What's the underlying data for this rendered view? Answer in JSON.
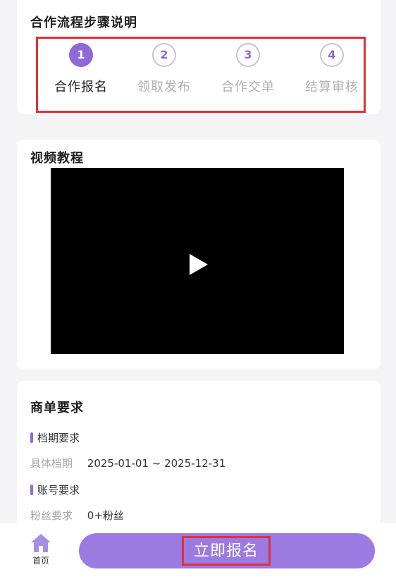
{
  "process": {
    "title": "合作流程步骤说明",
    "steps": [
      {
        "num": "1",
        "label": "合作报名",
        "active": true
      },
      {
        "num": "2",
        "label": "领取发布",
        "active": false
      },
      {
        "num": "3",
        "label": "合作交单",
        "active": false
      },
      {
        "num": "4",
        "label": "结算审核",
        "active": false
      }
    ]
  },
  "video": {
    "title": "视频教程",
    "icon": "play-icon"
  },
  "requirements": {
    "title": "商单要求",
    "schedule": {
      "heading": "档期要求",
      "key": "具体档期",
      "value": "2025-01-01 ~ 2025-12-31"
    },
    "account": {
      "heading": "账号要求",
      "key": "粉丝要求",
      "value": "0+粉丝"
    }
  },
  "bottom_bar": {
    "home_label": "首页",
    "home_icon": "home-icon",
    "signup_label": "立即报名"
  },
  "colors": {
    "accent": "#8e6ad8",
    "button": "#9b7ae2",
    "highlight_border": "#e0303b"
  }
}
